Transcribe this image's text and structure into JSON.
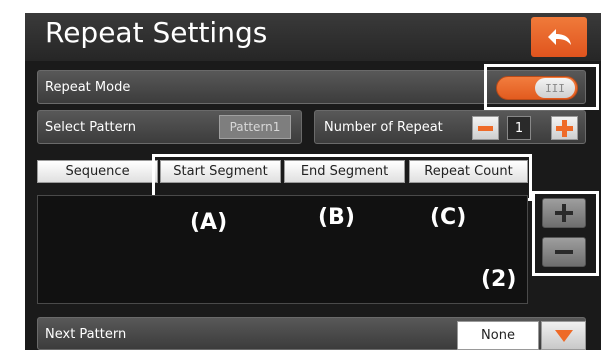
{
  "header": {
    "title": "Repeat Settings",
    "back_icon": "back-arrow-icon"
  },
  "repeat_mode": {
    "label": "Repeat Mode",
    "toggle_on": true,
    "toggle_grip": "III"
  },
  "select_pattern": {
    "label": "Select Pattern",
    "value": "Pattern1"
  },
  "number_of_repeat": {
    "label": "Number of Repeat",
    "value": "1",
    "minus_icon": "minus-icon",
    "plus_icon": "plus-icon"
  },
  "tabs": [
    {
      "label": "Sequence"
    },
    {
      "label": "Start Segment"
    },
    {
      "label": "End Segment"
    },
    {
      "label": "Repeat Count"
    }
  ],
  "side_buttons": {
    "add_icon": "plus-icon",
    "remove_icon": "minus-icon"
  },
  "callouts": {
    "a": "(A)",
    "b": "(B)",
    "c": "(C)",
    "two": "(2)"
  },
  "next_pattern": {
    "label": "Next Pattern",
    "value": "None",
    "dropdown_icon": "triangle-down-icon"
  },
  "colors": {
    "accent": "#ee6a28",
    "panel": "#1a1a1a",
    "bar": "#4a4a4a"
  }
}
